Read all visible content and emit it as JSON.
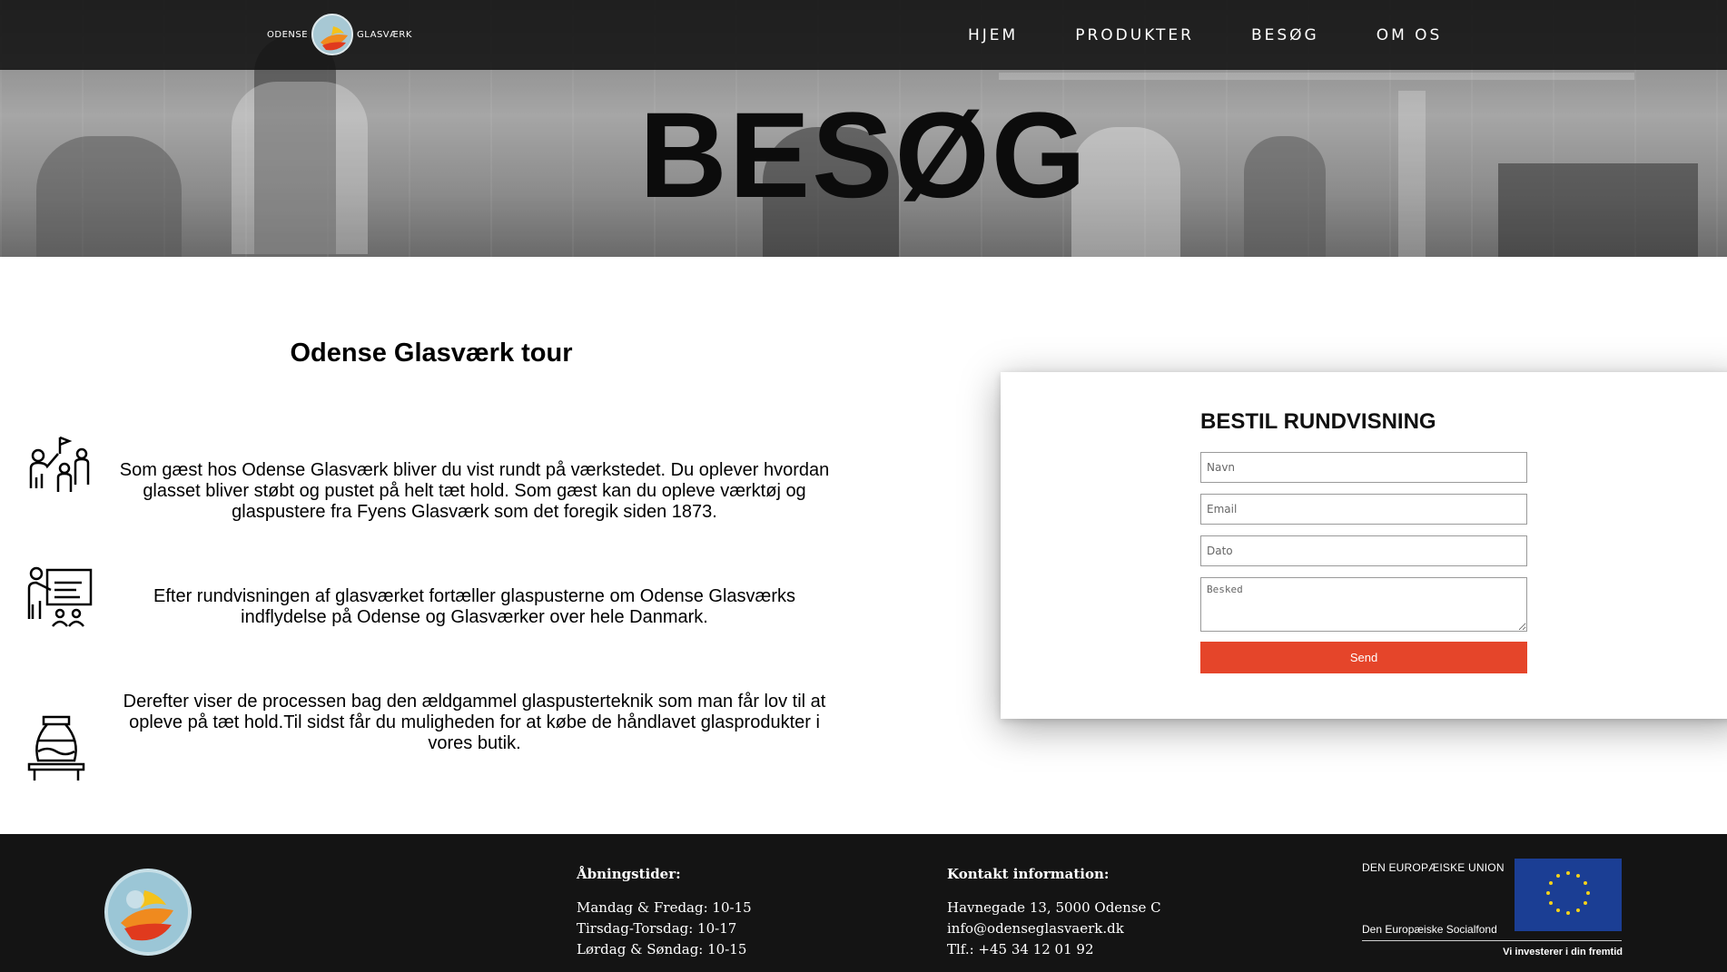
{
  "nav": {
    "logo_left": "ODENSE",
    "logo_right": "GLASVÆRK",
    "items": [
      {
        "label": "HJEM"
      },
      {
        "label": "PRODUKTER"
      },
      {
        "label": "BESØG"
      },
      {
        "label": "OM OS"
      }
    ]
  },
  "hero": {
    "title": "BESØG"
  },
  "tour": {
    "title": "Odense Glasværk tour",
    "features": [
      {
        "icon": "group-tour-icon",
        "text": "Som gæst hos Odense Glasværk bliver du vist rundt på værkstedet. Du oplever hvordan glasset bliver støbt og pustet på helt tæt hold. Som gæst kan du opleve værktøj og glaspustere fra Fyens Glasværk som det foregik siden 1873."
      },
      {
        "icon": "presentation-icon",
        "text": "Efter rundvisningen af glasværket fortæller glaspusterne om Odense Glasværks indflydelse på Odense og Glasværker over hele Danmark."
      },
      {
        "icon": "vase-icon",
        "text": "Derefter viser de processen bag den ældgammel glaspusterteknik som man får lov til at opleve på tæt hold.Til sidst får du muligheden for at købe de håndlavet glasprodukter i vores butik."
      }
    ]
  },
  "booking": {
    "title": "BESTIL RUNDVISNING",
    "fields": {
      "name_placeholder": "Navn",
      "email_placeholder": "Email",
      "date_placeholder": "Dato",
      "message_placeholder": "Besked"
    },
    "send_label": "Send",
    "accent": "#e5452a"
  },
  "footer": {
    "hours": {
      "heading": "Åbningstider:",
      "lines": [
        "Mandag & Fredag: 10-15",
        "Tirsdag-Torsdag: 10-17",
        "Lørdag & Søndag: 10-15"
      ]
    },
    "contact": {
      "heading": "Kontakt information:",
      "lines": [
        "Havnegade 13, 5000 Odense C",
        "info@odenseglasvaerk.dk",
        "Tlf.: +45 34 12 01 92"
      ]
    },
    "eu": {
      "title": "DEN EUROPÆISKE UNION",
      "fund": "Den Europæiske Socialfond",
      "slogan": "Vi investerer i din fremtid"
    }
  }
}
